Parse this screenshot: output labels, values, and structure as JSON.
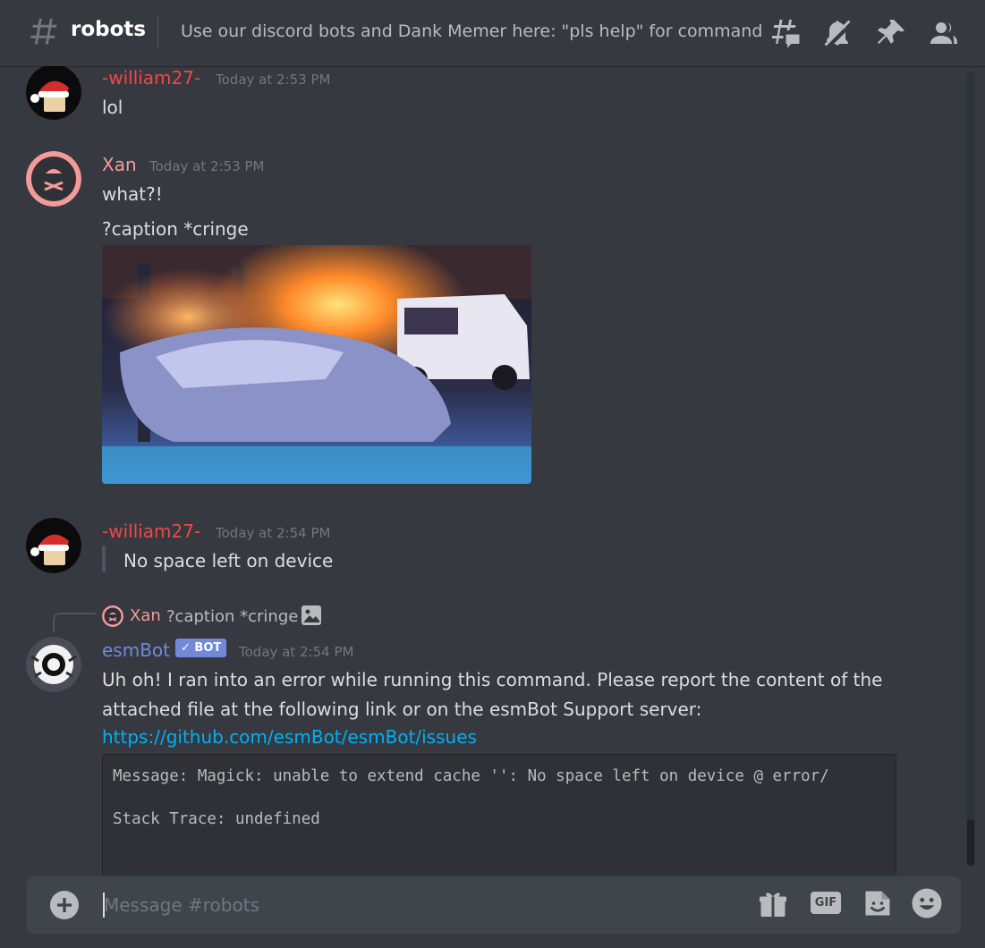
{
  "header": {
    "channel_name": "robots",
    "topic": "Use our discord bots and Dank Memer here: \"pls help\" for commands li...",
    "icons": [
      "threads-icon",
      "mute-bell-icon",
      "pin-icon",
      "members-icon"
    ]
  },
  "messages": [
    {
      "author": "-william27-",
      "author_color": "#f04747",
      "timestamp": "Today at 2:53 PM",
      "lines": [
        "lol"
      ]
    },
    {
      "author": "Xan",
      "author_color": "#f59a9a",
      "timestamp": "Today at 2:53 PM",
      "lines": [
        "what?!",
        "?caption *cringe"
      ],
      "attachment": "gif-image"
    },
    {
      "author": "-william27-",
      "author_color": "#f04747",
      "timestamp": "Today at 2:54 PM",
      "quote": "No space left on device"
    },
    {
      "reply_to": {
        "author": "Xan",
        "text": "?caption *cringe"
      },
      "author": "esmBot",
      "author_color": "#7289da",
      "bot_tag": "✓ BOT",
      "timestamp": "Today at 2:54 PM",
      "lines": [
        "Uh oh! I ran into an error while running this command. Please report the content of the",
        "attached file at the following link or on the esmBot Support server:"
      ],
      "link": "https://github.com/esmBot/esmBot/issues",
      "code": [
        "Message: Magick: unable to extend cache '': No space left on device @ error/",
        "Stack Trace: undefined"
      ]
    }
  ],
  "composer": {
    "placeholder": "Message #robots",
    "icons": [
      "add-attachment-icon",
      "gift-icon",
      "gif-icon",
      "sticker-icon",
      "emoji-icon"
    ],
    "gif_label": "GIF"
  },
  "colors": {
    "background": "#36393f",
    "link": "#00b0f4",
    "bot_tag": "#7289da"
  }
}
